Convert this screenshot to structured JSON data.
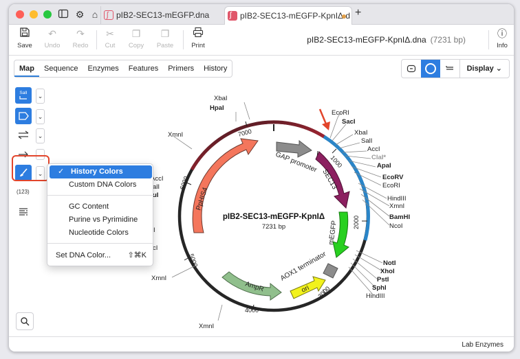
{
  "tabs": [
    {
      "label": "pIB2-SEC13-mEGFP.dna"
    },
    {
      "label": "pIB2-SEC13-mEGFP-KpnIΔ.d"
    }
  ],
  "toolbar": {
    "save": "Save",
    "undo": "Undo",
    "redo": "Redo",
    "cut": "Cut",
    "copy": "Copy",
    "paste": "Paste",
    "print": "Print",
    "info": "Info"
  },
  "file": {
    "name": "pIB2-SEC13-mEGFP-KpnIΔ.dna",
    "length": "(7231 bp)"
  },
  "nav": [
    "Map",
    "Sequence",
    "Enzymes",
    "Features",
    "Primers",
    "History"
  ],
  "view": {
    "display": "Display"
  },
  "left": {
    "sali": "SalI",
    "count": "(123)"
  },
  "menu": {
    "history": "History Colors",
    "custom": "Custom DNA Colors",
    "gc": "GC Content",
    "purine": "Purine vs Pyrimidine",
    "nucleotide": "Nucleotide Colors",
    "setcolor": "Set DNA Color...",
    "shortcut": "⇧⌘K"
  },
  "map": {
    "name": "pIB2-SEC13-mEGFP-KpnIΔ",
    "size": "7231 bp",
    "ticks": [
      "1000",
      "2000",
      "3000",
      "4000",
      "5000",
      "6000",
      "7000"
    ],
    "features": [
      "GAP promoter",
      "SEC13",
      "mEGFP",
      "AOX1 terminator",
      "ori",
      "AmpR",
      "PpHIS4"
    ],
    "enzymes": {
      "EcoRI": "EcoRI",
      "SacI": "SacI",
      "XbaI": "XbaI",
      "SalI": "SalI",
      "AccI": "AccI",
      "ClaI": "ClaI*",
      "ApaI": "ApaI",
      "EcoRV": "EcoRV",
      "EcoRI2": "EcoRI",
      "HindIII": "HindIII",
      "XmnI": "XmnI",
      "BamHI": "BamHI",
      "NcoI": "NcoI",
      "NotI": "NotI",
      "XhoI": "XhoI",
      "PstI": "PstI",
      "SphI": "SphI",
      "HindIII2": "HindIII",
      "XmnI2": "XmnI",
      "XmnI3": "XmnI",
      "XmnI4": "XmnI",
      "HpaI": "HpaI",
      "XbaI2": "XbaI",
      "AccIc": "AccI",
      "SalIc": "alI",
      "uI": "uI",
      "cI1": "I",
      "cI2": "cI"
    }
  },
  "status": {
    "enzymes": "Lab Enzymes"
  }
}
